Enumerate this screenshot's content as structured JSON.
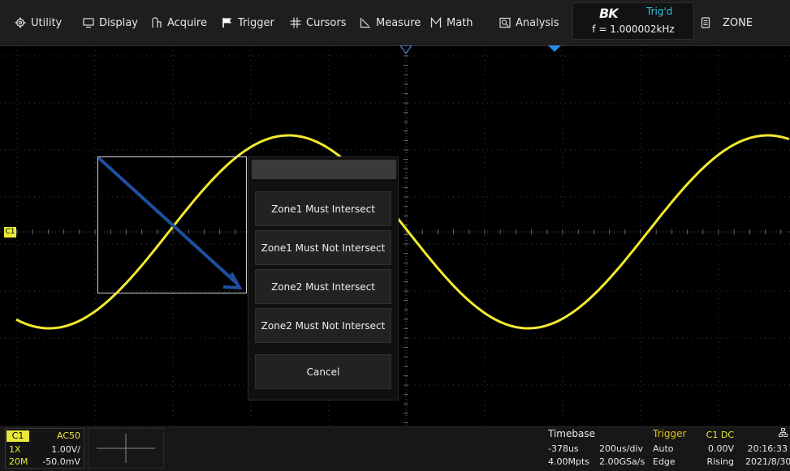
{
  "menu": [
    {
      "label": "Utility",
      "icon": "gear-icon"
    },
    {
      "label": "Display",
      "icon": "monitor-icon"
    },
    {
      "label": "Acquire",
      "icon": "acquire-icon"
    },
    {
      "label": "Trigger",
      "icon": "flag-icon"
    },
    {
      "label": "Cursors",
      "icon": "cursors-icon"
    },
    {
      "label": "Measure",
      "icon": "measure-icon"
    },
    {
      "label": "Math",
      "icon": "math-icon"
    },
    {
      "label": "Analysis",
      "icon": "analysis-icon"
    }
  ],
  "status": {
    "brand": "BK",
    "state": "Trig'd",
    "frequency": "f = 1.000002kHz"
  },
  "zone_menu": {
    "label": "ZONE",
    "icon": "document-icon"
  },
  "popup": {
    "options": [
      "Zone1 Must Intersect",
      "Zone1 Must Not Intersect",
      "Zone2 Must Intersect",
      "Zone2 Must Not Intersect"
    ],
    "cancel": "Cancel"
  },
  "channel": {
    "name": "C1",
    "marker": "C1",
    "coupling": "AC50",
    "probe": "1X",
    "scale": "1.00V/",
    "bandwidth": "20M",
    "offset": "-50.0mV",
    "color": "#e8e83a"
  },
  "timebase": {
    "title": "Timebase",
    "delay": "-378us",
    "scale": "200us/div",
    "memory": "4.00Mpts",
    "sample_rate": "2.00GSa/s"
  },
  "trigger": {
    "title": "Trigger",
    "source": "C1 DC",
    "mode": "Auto",
    "level": "0.00V",
    "type": "Edge",
    "slope": "Rising"
  },
  "clock": {
    "time": "20:16:33",
    "date": "2021/8/30",
    "icon": "network-icon"
  },
  "colors": {
    "trace": "#f2ea2e",
    "arrow": "#1f4fa0",
    "accent": "#2e8ae6",
    "trigger_title": "#e0c020",
    "status": "#35c7e0"
  }
}
